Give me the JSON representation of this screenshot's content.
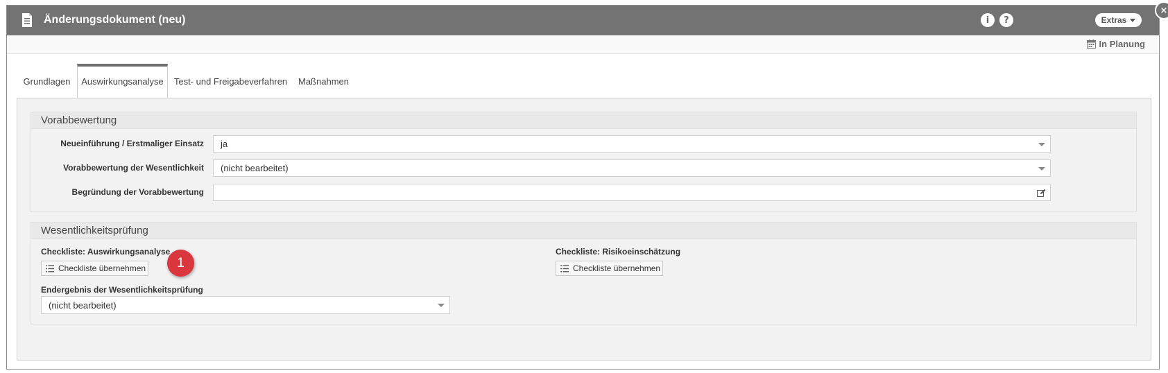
{
  "dialog": {
    "title": "Änderungsdokument (neu)",
    "info_label": "i",
    "help_label": "?",
    "extras_label": "Extras",
    "close_label": "×",
    "status": "In Planung"
  },
  "tabs": [
    {
      "label": "Grundlagen",
      "active": false
    },
    {
      "label": "Auswirkungsanalyse",
      "active": true
    },
    {
      "label": "Test- und Freigabeverfahren",
      "active": false
    },
    {
      "label": "Maßnahmen",
      "active": false
    }
  ],
  "vorabbewertung": {
    "heading": "Vorabbewertung",
    "rows": [
      {
        "label": "Neueinführung / Erstmaliger Einsatz",
        "value": "ja",
        "control": "select"
      },
      {
        "label": "Vorabbewertung der Wesentlichkeit",
        "value": "(nicht bearbeitet)",
        "control": "select"
      },
      {
        "label": "Begründung der Vorabbewertung",
        "value": "",
        "control": "text-edit"
      }
    ]
  },
  "wesentlichkeit": {
    "heading": "Wesentlichkeitsprüfung",
    "checklist_left_label": "Checkliste: Auswirkungsanalyse",
    "checklist_left_button": "Checkliste übernehmen",
    "checklist_right_label": "Checkliste: Risikoeinschätzung",
    "checklist_right_button": "Checkliste übernehmen",
    "result_label": "Endergebnis der Wesentlichkeitsprüfung",
    "result_value": "(nicht bearbeitet)"
  },
  "annotation_marker": "1",
  "colors": {
    "titlebar": "#737373",
    "marker": "#d9363e",
    "panel": "#f2f2f2"
  }
}
